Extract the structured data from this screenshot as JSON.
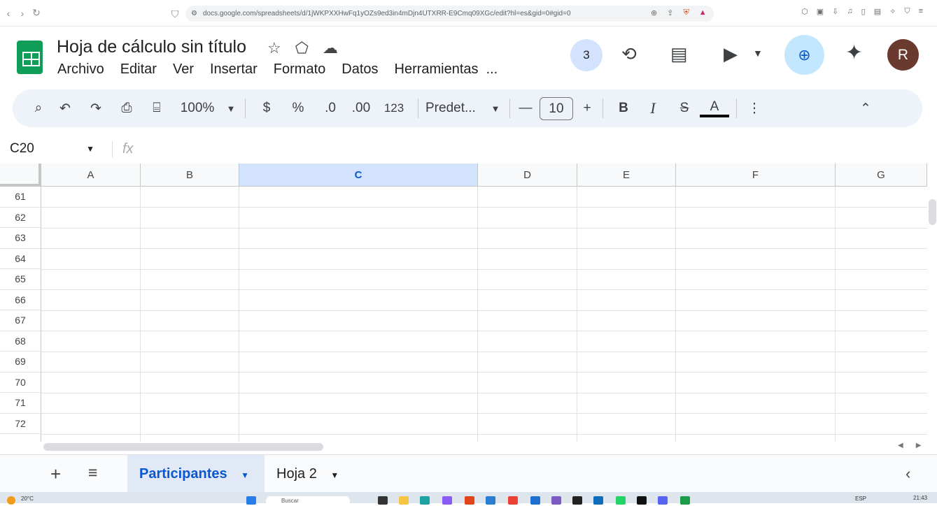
{
  "browser": {
    "url": "docs.google.com/spreadsheets/d/1jWKPXXHwFq1yOZs9ed3in4mDjn4UTXRR-E9Cmq09XGc/edit?hl=es&gid=0#gid=0"
  },
  "app": {
    "title": "Hoja de cálculo sin título",
    "menu": [
      "Archivo",
      "Editar",
      "Ver",
      "Insertar",
      "Formato",
      "Datos",
      "Herramientas",
      "..."
    ],
    "presence_count": "3",
    "avatar_letter": "R"
  },
  "toolbar": {
    "zoom": "100%",
    "currency": "$",
    "percent": "%",
    "dec_decrease": ".0",
    "dec_increase": ".00",
    "number_format": "123",
    "font": "Predet...",
    "font_size": "10",
    "bold": "B",
    "italic": "I",
    "text_color": "A"
  },
  "formula_bar": {
    "cell_ref": "C20",
    "fx": "fx"
  },
  "grid": {
    "columns": [
      "A",
      "B",
      "C",
      "D",
      "E",
      "F",
      "G"
    ],
    "selected_column": "C",
    "rows": [
      "61",
      "62",
      "63",
      "64",
      "65",
      "66",
      "67",
      "68",
      "69",
      "70",
      "71",
      "72"
    ]
  },
  "sheets": {
    "tabs": [
      "Participantes",
      "Hoja 2"
    ],
    "active": "Participantes"
  },
  "taskbar": {
    "temperature": "20°C",
    "search_placeholder": "Buscar",
    "language": "ESP",
    "time": "21:43"
  },
  "colors": {
    "sheets_green": "#0f9d58",
    "selected_col": "#d3e3fd",
    "accent_blue": "#0b57d0"
  }
}
